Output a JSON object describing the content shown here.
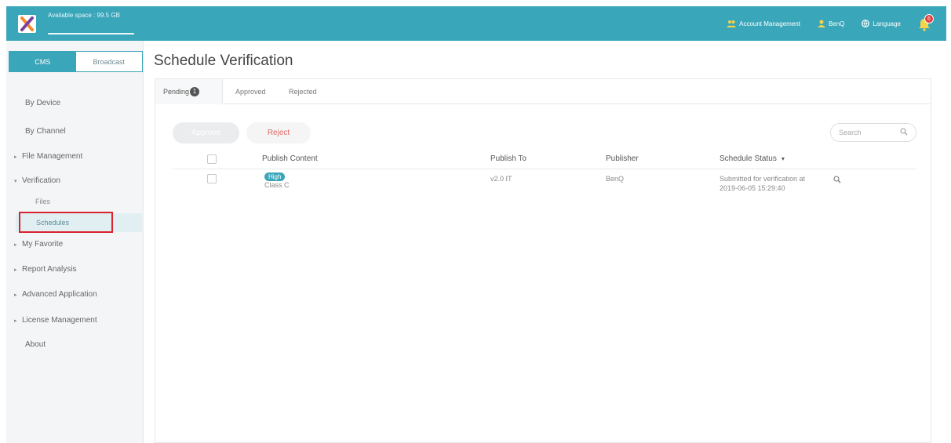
{
  "header": {
    "available_space": "Available space : 99.5 GB",
    "account_management": "Account Management",
    "user": "BenQ",
    "language": "Language",
    "notification_count": "6"
  },
  "sidebar": {
    "modes": [
      "CMS",
      "Broadcast"
    ],
    "active_mode": "CMS",
    "items": {
      "by_device": "By Device",
      "by_channel": "By Channel",
      "file_management": "File Management",
      "verification": "Verification",
      "verification_files": "Files",
      "verification_schedules": "Schedules",
      "my_favorite": "My Favorite",
      "report_analysis": "Report Analysis",
      "advanced_application": "Advanced Application",
      "license_management": "License Management",
      "about": "About"
    }
  },
  "main": {
    "title": "Schedule Verification",
    "tabs": {
      "pending": "Pending",
      "pending_count": "1",
      "approved": "Approved",
      "rejected": "Rejected"
    },
    "actions": {
      "approve": "Approve",
      "reject": "Reject"
    },
    "search": {
      "placeholder": "Search"
    },
    "table": {
      "headers": {
        "publish_content": "Publish Content",
        "publish_to": "Publish To",
        "publisher": "Publisher",
        "schedule_status": "Schedule Status"
      },
      "rows": [
        {
          "priority": "High",
          "content": "Class C",
          "publish_to": "v2.0 IT",
          "publisher": "BenQ",
          "status_line1": "Submitted for verification at",
          "status_line2": "2019-06-05 15:29:40"
        }
      ]
    }
  },
  "colors": {
    "accent": "#3aa6b9",
    "highlight": "#d9232e",
    "reject": "#e36a6a"
  },
  "icons": {
    "logo": "app-logo-icon",
    "account": "account-group-icon",
    "user": "user-icon",
    "language": "globe-icon",
    "notifications": "bell-icon",
    "search": "search-icon",
    "sort": "caret-down-icon",
    "expand": "caret-right-icon"
  }
}
